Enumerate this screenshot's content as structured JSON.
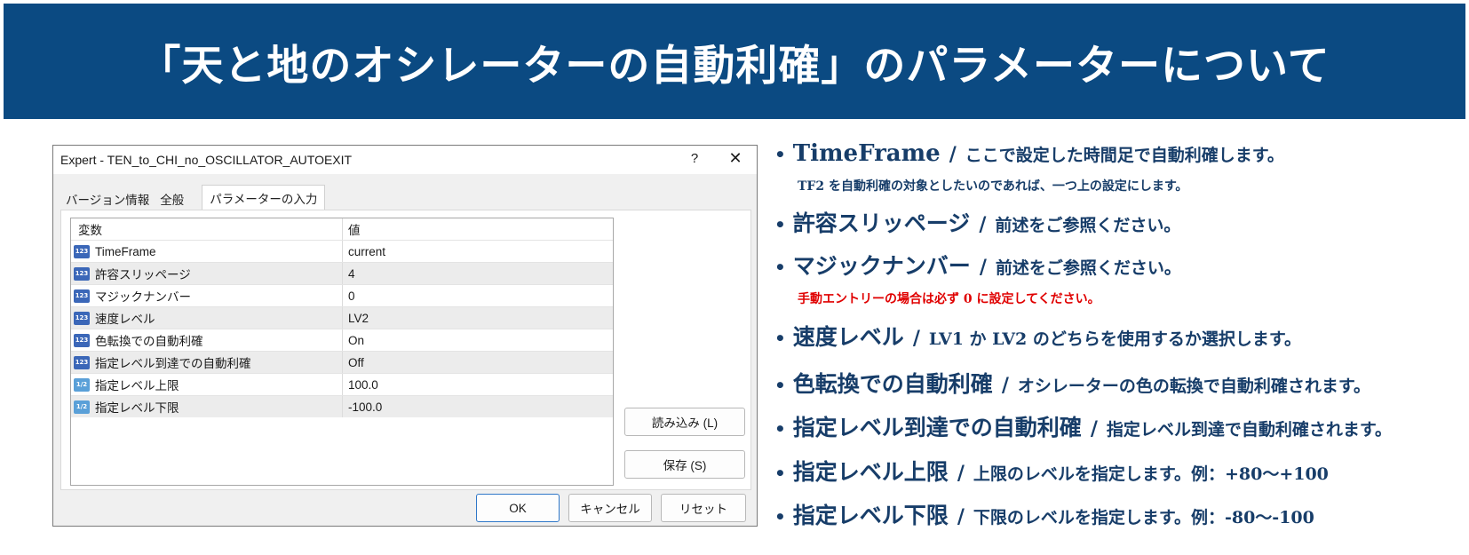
{
  "banner": {
    "title": "「天と地のオシレーターの自動利確」のパラメーターについて"
  },
  "dialog": {
    "title": "Expert - TEN_to_CHI_no_OSCILLATOR_AUTOEXIT",
    "help": "?",
    "close": "✕",
    "tabs": [
      "バージョン情報",
      "全般",
      "パラメーターの入力"
    ],
    "columns": [
      "変数",
      "値"
    ],
    "rows": [
      {
        "icon": "123",
        "name": "TimeFrame",
        "value": "current"
      },
      {
        "icon": "123",
        "name": "許容スリッページ",
        "value": "4"
      },
      {
        "icon": "123",
        "name": "マジックナンバー",
        "value": "0"
      },
      {
        "icon": "123",
        "name": "速度レベル",
        "value": "LV2"
      },
      {
        "icon": "123",
        "name": "色転換での自動利確",
        "value": "On"
      },
      {
        "icon": "123",
        "name": "指定レベル到達での自動利確",
        "value": "Off"
      },
      {
        "icon": "1/2",
        "name": "指定レベル上限",
        "value": "100.0"
      },
      {
        "icon": "1/2",
        "name": "指定レベル下限",
        "value": "-100.0"
      }
    ],
    "buttons": {
      "load": "読み込み (L)",
      "save": "保存 (S)",
      "ok": "OK",
      "cancel": "キャンセル",
      "reset": "リセット"
    }
  },
  "descriptions": [
    {
      "label": "TimeFrame",
      "text": "ここで設定した時間足で自動利確します。"
    },
    {
      "label": "許容スリッページ",
      "text": "前述をご参照ください。"
    },
    {
      "label": "マジックナンバー",
      "text": "前述をご参照ください。"
    },
    {
      "label": "速度レベル",
      "text": "LV1 か LV2 のどちらを使用するか選択します。"
    },
    {
      "label": "色転換での自動利確",
      "text": "オシレーターの色の転換で自動利確されます。"
    },
    {
      "label": "指定レベル到達での自動利確",
      "text": "指定レベル到達で自動利確されます。"
    },
    {
      "label": "指定レベル上限",
      "text": "上限のレベルを指定します。例：+80～+100"
    },
    {
      "label": "指定レベル下限",
      "text": "下限のレベルを指定します。例：-80～-100"
    }
  ],
  "notes": {
    "timeframe": "TF2 を自動利確の対象としたいのであれば、一つ上の設定にします。",
    "magic": "手動エントリーの場合は必ず 0 に設定してください。"
  },
  "separator": "/",
  "bullet": "•",
  "colors": {
    "banner": "#0b4a82",
    "desc_text": "#173d69",
    "warning": "#e00000",
    "primary_button_border": "#2f77c8"
  }
}
